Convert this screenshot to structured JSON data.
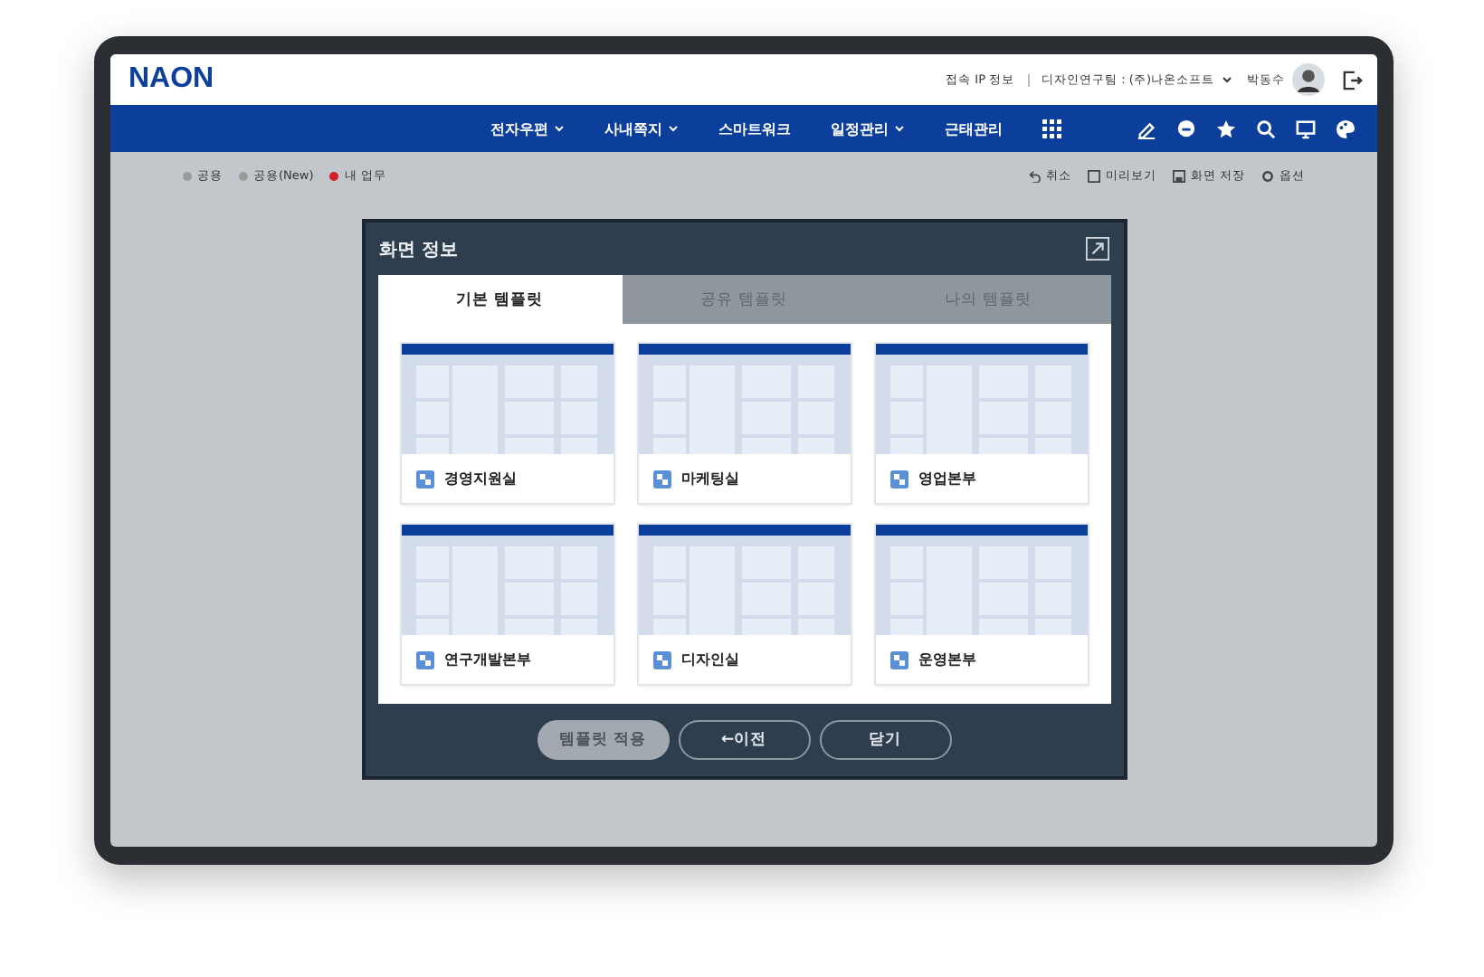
{
  "header": {
    "logo": "NAON",
    "ip_info": "접속 IP 정보",
    "org": "디자인연구팀 : (주)나온소프트",
    "user": "박동수"
  },
  "nav": {
    "items": [
      {
        "label": "전자우편",
        "dropdown": true
      },
      {
        "label": "사내쪽지",
        "dropdown": true
      },
      {
        "label": "스마트워크",
        "dropdown": false
      },
      {
        "label": "일정관리",
        "dropdown": true
      },
      {
        "label": "근태관리",
        "dropdown": false
      }
    ]
  },
  "legend": [
    {
      "label": "공용",
      "color": "#9a9a9a"
    },
    {
      "label": "공용(New)",
      "color": "#9a9a9a"
    },
    {
      "label": "내 업무",
      "color": "#d0202a"
    }
  ],
  "actions": [
    {
      "label": "취소",
      "kind": "undo"
    },
    {
      "label": "미리보기",
      "kind": "preview"
    },
    {
      "label": "화면 저장",
      "kind": "save"
    },
    {
      "label": "옵션",
      "kind": "option"
    }
  ],
  "dialog": {
    "title": "화면 정보",
    "tabs": [
      {
        "label": "기본 템플릿",
        "selected": true
      },
      {
        "label": "공유 템플릿",
        "selected": false
      },
      {
        "label": "나의 템플릿",
        "selected": false
      }
    ],
    "templates": [
      "경영지원실",
      "마케팅실",
      "영업본부",
      "연구개발본부",
      "디자인실",
      "운영본부"
    ],
    "buttons": [
      {
        "label": "템플릿 적용",
        "kind": "filled"
      },
      {
        "label": "←이전",
        "kind": "outline"
      },
      {
        "label": "닫기",
        "kind": "outline"
      }
    ]
  }
}
